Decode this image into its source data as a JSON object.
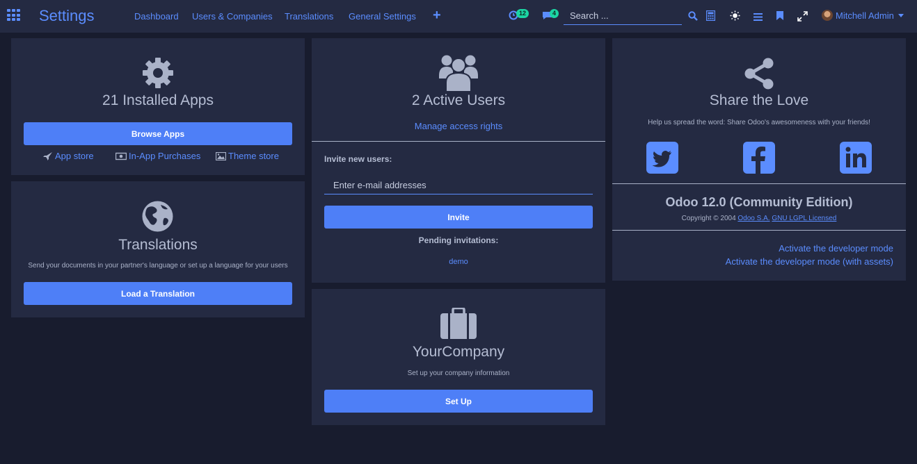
{
  "header": {
    "brand": "Settings",
    "menu": [
      "Dashboard",
      "Users & Companies",
      "Translations",
      "General Settings"
    ],
    "activity_count": "12",
    "message_count": "4",
    "search_placeholder": "Search ...",
    "user_name": "Mitchell Admin"
  },
  "apps_card": {
    "title": "21 Installed Apps",
    "browse_button": "Browse Apps",
    "links": [
      "App store",
      "In-App Purchases",
      "Theme store"
    ]
  },
  "translations_card": {
    "title": "Translations",
    "description": "Send your documents in your partner's language or set up a language for your users",
    "button": "Load a Translation"
  },
  "users_card": {
    "title": "2 Active Users",
    "manage_link": "Manage access rights",
    "invite_label": "Invite new users:",
    "invite_placeholder": "Enter e-mail addresses",
    "invite_button": "Invite",
    "pending_label": "Pending invitations:",
    "pending_users": [
      "demo"
    ]
  },
  "company_card": {
    "title": "YourCompany",
    "description": "Set up your company information",
    "button": "Set Up"
  },
  "share_card": {
    "title": "Share the Love",
    "description": "Help us spread the word: Share Odoo's awesomeness with your friends!",
    "social": [
      "twitter-icon",
      "facebook-icon",
      "linkedin-icon"
    ],
    "version": "Odoo 12.0 (Community Edition)",
    "copyright_prefix": "Copyright © 2004",
    "company_link": "Odoo S.A.",
    "license_link": "GNU LGPL Licensed",
    "dev_mode": "Activate the developer mode",
    "dev_mode_assets": "Activate the developer mode (with assets)"
  },
  "colors": {
    "accent": "#5b8dff",
    "button": "#4e7ff7",
    "card_bg": "#242a42",
    "page_bg": "#181c2e",
    "badge": "#1bd5a3"
  }
}
